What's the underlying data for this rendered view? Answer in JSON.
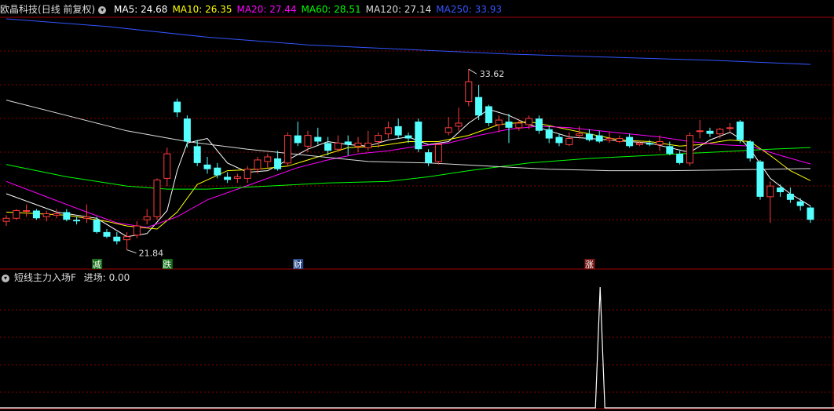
{
  "header": {
    "stock_name": "欧晶科技",
    "mode": "(日线 前复权)",
    "toggle_icon": "chevron-down-icon",
    "ma": [
      {
        "label": "MA5: ",
        "value": "24.68",
        "color": "#ffffff"
      },
      {
        "label": "MA10: ",
        "value": "26.35",
        "color": "#ffff00"
      },
      {
        "label": "MA20: ",
        "value": "27.44",
        "color": "#ff00ff"
      },
      {
        "label": "MA60: ",
        "value": "28.51",
        "color": "#00ff00"
      },
      {
        "label": "MA120: ",
        "value": "27.14",
        "color": "#dddddd"
      },
      {
        "label": "MA250: ",
        "value": "33.93",
        "color": "#3355ff"
      }
    ]
  },
  "indicator": {
    "name": "短线主力入场F",
    "label": "进场: ",
    "value": "0.00",
    "signal": {
      "index": 59,
      "value": 1
    }
  },
  "annotations": {
    "high_label": "33.62",
    "low_label": "21.84",
    "tags": [
      {
        "text": "减",
        "index": 9,
        "bg": "#1a6e1a"
      },
      {
        "text": "跌",
        "index": 16,
        "bg": "#1a6e1a"
      },
      {
        "text": "财",
        "index": 29,
        "bg": "#2a4a8a"
      },
      {
        "text": "涨",
        "index": 58,
        "bg": "#7a1a1a"
      }
    ]
  },
  "colors": {
    "up": "#ff3c3c",
    "down": "#54ffff",
    "grid": "#8a0000",
    "bg": "#000000"
  },
  "chart_data": {
    "type": "candlestick",
    "ylim": [
      21.0,
      37.0
    ],
    "candles": [
      [
        23.7,
        24.1,
        23.4,
        23.9
      ],
      [
        23.9,
        24.5,
        23.8,
        24.4
      ],
      [
        24.4,
        24.8,
        24.0,
        24.4
      ],
      [
        24.4,
        24.5,
        23.8,
        23.9
      ],
      [
        24.0,
        24.4,
        23.7,
        24.2
      ],
      [
        24.1,
        24.5,
        23.9,
        24.2
      ],
      [
        24.3,
        24.5,
        23.7,
        23.8
      ],
      [
        23.8,
        24.0,
        23.5,
        23.7
      ],
      [
        23.9,
        24.8,
        23.6,
        24.0
      ],
      [
        23.8,
        24.0,
        22.9,
        23.0
      ],
      [
        23.0,
        23.2,
        22.6,
        22.7
      ],
      [
        22.7,
        23.0,
        22.2,
        22.4
      ],
      [
        22.5,
        23.0,
        21.84,
        22.7
      ],
      [
        22.8,
        23.7,
        22.6,
        23.4
      ],
      [
        23.8,
        24.5,
        23.5,
        24.0
      ],
      [
        24.0,
        26.5,
        23.8,
        26.4
      ],
      [
        26.5,
        28.5,
        26.0,
        28.1
      ],
      [
        31.5,
        31.7,
        30.5,
        30.8
      ],
      [
        30.4,
        30.6,
        28.5,
        28.9
      ],
      [
        28.6,
        29.0,
        27.3,
        27.5
      ],
      [
        27.4,
        27.9,
        26.8,
        27.1
      ],
      [
        27.2,
        27.5,
        26.5,
        26.7
      ],
      [
        26.6,
        26.9,
        26.2,
        26.4
      ],
      [
        26.5,
        26.8,
        26.2,
        26.6
      ],
      [
        26.5,
        27.3,
        26.2,
        27.1
      ],
      [
        27.1,
        27.9,
        26.8,
        27.7
      ],
      [
        27.6,
        28.1,
        27.2,
        27.9
      ],
      [
        27.8,
        28.3,
        27.0,
        27.1
      ],
      [
        27.5,
        29.5,
        27.3,
        29.3
      ],
      [
        29.3,
        30.2,
        28.6,
        28.8
      ],
      [
        28.6,
        29.6,
        28.2,
        29.3
      ],
      [
        29.2,
        29.8,
        28.7,
        28.9
      ],
      [
        28.8,
        29.2,
        28.0,
        28.3
      ],
      [
        28.4,
        29.3,
        28.3,
        28.8
      ],
      [
        28.9,
        29.3,
        28.0,
        28.7
      ],
      [
        28.6,
        29.2,
        28.2,
        28.8
      ],
      [
        28.5,
        29.6,
        28.3,
        28.8
      ],
      [
        28.9,
        29.5,
        28.5,
        29.3
      ],
      [
        29.4,
        30.2,
        29.1,
        29.8
      ],
      [
        29.9,
        30.4,
        29.1,
        29.3
      ],
      [
        29.3,
        29.5,
        28.8,
        29.1
      ],
      [
        30.2,
        30.4,
        28.2,
        28.4
      ],
      [
        28.2,
        28.4,
        27.3,
        27.5
      ],
      [
        27.6,
        28.8,
        27.4,
        28.7
      ],
      [
        29.5,
        30.5,
        29.3,
        29.8
      ],
      [
        29.9,
        31.1,
        29.6,
        30.1
      ],
      [
        31.5,
        33.62,
        31.2,
        32.8
      ],
      [
        31.8,
        32.6,
        30.3,
        30.6
      ],
      [
        31.2,
        31.3,
        29.9,
        30.1
      ],
      [
        30.0,
        30.6,
        29.5,
        30.3
      ],
      [
        30.2,
        30.7,
        28.8,
        29.8
      ],
      [
        29.8,
        30.3,
        29.6,
        30.1
      ],
      [
        30.0,
        30.6,
        29.7,
        30.4
      ],
      [
        30.4,
        30.6,
        29.4,
        29.6
      ],
      [
        29.7,
        29.9,
        28.8,
        29.1
      ],
      [
        29.2,
        29.4,
        28.6,
        28.8
      ],
      [
        28.7,
        29.5,
        28.6,
        29.1
      ],
      [
        29.3,
        29.9,
        29.1,
        29.4
      ],
      [
        29.4,
        29.7,
        28.9,
        29.0
      ],
      [
        29.3,
        29.6,
        28.8,
        28.9
      ],
      [
        29.0,
        29.5,
        28.8,
        29.1
      ],
      [
        28.9,
        29.3,
        28.8,
        29.1
      ],
      [
        29.2,
        29.4,
        28.5,
        28.6
      ],
      [
        28.7,
        28.9,
        28.6,
        28.8
      ],
      [
        28.8,
        29.0,
        28.6,
        28.7
      ],
      [
        28.7,
        29.3,
        28.3,
        28.9
      ],
      [
        28.6,
        28.9,
        28.0,
        28.1
      ],
      [
        28.1,
        28.3,
        27.4,
        27.5
      ],
      [
        27.5,
        29.5,
        27.3,
        29.3
      ],
      [
        29.6,
        30.3,
        29.1,
        29.6
      ],
      [
        29.6,
        29.8,
        29.2,
        29.4
      ],
      [
        29.4,
        29.8,
        29.1,
        29.7
      ],
      [
        29.8,
        30.1,
        29.5,
        29.8
      ],
      [
        30.2,
        30.3,
        28.8,
        29.0
      ],
      [
        28.9,
        29.0,
        27.6,
        27.8
      ],
      [
        27.6,
        27.7,
        25.1,
        25.3
      ],
      [
        25.3,
        26.3,
        23.6,
        26.0
      ],
      [
        25.9,
        26.1,
        25.3,
        25.6
      ],
      [
        25.5,
        25.9,
        24.9,
        25.1
      ],
      [
        25.0,
        25.2,
        24.4,
        24.7
      ],
      [
        24.6,
        24.7,
        23.6,
        23.8
      ]
    ],
    "ma_lines": [
      {
        "name": "MA5",
        "color": "#ffffff",
        "values": [
          [
            0,
            25.5
          ],
          [
            5,
            24.3
          ],
          [
            9,
            23.9
          ],
          [
            12,
            22.7
          ],
          [
            14,
            22.9
          ],
          [
            16,
            24.4
          ],
          [
            17,
            27.0
          ],
          [
            18,
            28.8
          ],
          [
            20,
            29.1
          ],
          [
            22,
            27.5
          ],
          [
            24,
            26.9
          ],
          [
            26,
            27.0
          ],
          [
            28,
            27.7
          ],
          [
            30,
            28.4
          ],
          [
            32,
            28.9
          ],
          [
            34,
            28.7
          ],
          [
            36,
            28.6
          ],
          [
            38,
            29.0
          ],
          [
            40,
            29.2
          ],
          [
            42,
            28.7
          ],
          [
            44,
            28.9
          ],
          [
            46,
            30.1
          ],
          [
            48,
            31.0
          ],
          [
            50,
            30.6
          ],
          [
            52,
            30.0
          ],
          [
            54,
            29.6
          ],
          [
            56,
            29.2
          ],
          [
            58,
            29.1
          ],
          [
            60,
            29.0
          ],
          [
            62,
            28.9
          ],
          [
            64,
            28.8
          ],
          [
            66,
            28.5
          ],
          [
            68,
            28.2
          ],
          [
            70,
            29.0
          ],
          [
            72,
            29.5
          ],
          [
            73,
            29.1
          ],
          [
            74,
            28.4
          ],
          [
            76,
            26.5
          ],
          [
            78,
            25.5
          ],
          [
            80,
            24.7
          ]
        ]
      },
      {
        "name": "MA10",
        "color": "#ffff00",
        "values": [
          [
            0,
            24.3
          ],
          [
            6,
            24.1
          ],
          [
            10,
            23.7
          ],
          [
            12,
            23.4
          ],
          [
            15,
            23.2
          ],
          [
            17,
            24.3
          ],
          [
            19,
            26.1
          ],
          [
            22,
            27.0
          ],
          [
            25,
            27.1
          ],
          [
            28,
            27.3
          ],
          [
            31,
            27.9
          ],
          [
            34,
            28.5
          ],
          [
            37,
            28.6
          ],
          [
            40,
            28.9
          ],
          [
            43,
            28.9
          ],
          [
            46,
            29.3
          ],
          [
            49,
            30.0
          ],
          [
            52,
            30.2
          ],
          [
            55,
            29.8
          ],
          [
            58,
            29.4
          ],
          [
            61,
            29.0
          ],
          [
            64,
            28.9
          ],
          [
            67,
            28.6
          ],
          [
            69,
            28.7
          ],
          [
            72,
            29.0
          ],
          [
            74,
            28.9
          ],
          [
            76,
            28.0
          ],
          [
            78,
            27.0
          ],
          [
            80,
            26.35
          ]
        ]
      },
      {
        "name": "MA20",
        "color": "#ff00ff",
        "values": [
          [
            0,
            26.3
          ],
          [
            4,
            25.3
          ],
          [
            8,
            24.3
          ],
          [
            11,
            23.6
          ],
          [
            14,
            23.3
          ],
          [
            17,
            24.0
          ],
          [
            20,
            25.1
          ],
          [
            23,
            25.8
          ],
          [
            26,
            26.5
          ],
          [
            29,
            27.2
          ],
          [
            32,
            27.7
          ],
          [
            35,
            28.1
          ],
          [
            38,
            28.3
          ],
          [
            41,
            28.6
          ],
          [
            44,
            28.8
          ],
          [
            47,
            29.3
          ],
          [
            50,
            29.7
          ],
          [
            53,
            29.9
          ],
          [
            56,
            29.8
          ],
          [
            59,
            29.6
          ],
          [
            62,
            29.4
          ],
          [
            65,
            29.2
          ],
          [
            68,
            28.9
          ],
          [
            71,
            28.7
          ],
          [
            74,
            28.6
          ],
          [
            77,
            28.0
          ],
          [
            80,
            27.44
          ]
        ]
      },
      {
        "name": "MA60",
        "color": "#00ff00",
        "values": [
          [
            0,
            27.4
          ],
          [
            6,
            26.6
          ],
          [
            12,
            26.0
          ],
          [
            16,
            25.8
          ],
          [
            20,
            25.8
          ],
          [
            26,
            26.0
          ],
          [
            32,
            26.2
          ],
          [
            38,
            26.3
          ],
          [
            42,
            26.6
          ],
          [
            46,
            27.0
          ],
          [
            52,
            27.5
          ],
          [
            58,
            27.8
          ],
          [
            64,
            28.0
          ],
          [
            70,
            28.2
          ],
          [
            76,
            28.4
          ],
          [
            80,
            28.51
          ]
        ]
      },
      {
        "name": "MA120",
        "color": "#dddddd",
        "values": [
          [
            0,
            31.6
          ],
          [
            6,
            30.6
          ],
          [
            12,
            29.6
          ],
          [
            18,
            28.9
          ],
          [
            24,
            28.4
          ],
          [
            30,
            28.0
          ],
          [
            36,
            27.6
          ],
          [
            42,
            27.5
          ],
          [
            48,
            27.3
          ],
          [
            54,
            27.1
          ],
          [
            60,
            27.0
          ],
          [
            66,
            27.0
          ],
          [
            72,
            27.05
          ],
          [
            80,
            27.14
          ]
        ]
      },
      {
        "name": "MA250",
        "color": "#3355ff",
        "values": [
          [
            0,
            36.9
          ],
          [
            10,
            36.4
          ],
          [
            20,
            35.7
          ],
          [
            30,
            35.2
          ],
          [
            40,
            34.9
          ],
          [
            50,
            34.6
          ],
          [
            60,
            34.4
          ],
          [
            70,
            34.2
          ],
          [
            80,
            33.93
          ]
        ]
      }
    ]
  }
}
